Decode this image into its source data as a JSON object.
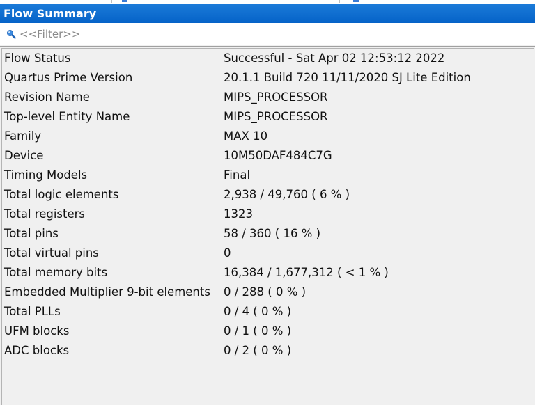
{
  "panel": {
    "title": "Flow Summary"
  },
  "filter": {
    "placeholder": "<<Filter>>",
    "value": ""
  },
  "summary_rows": [
    {
      "key": "Flow Status",
      "value": "Successful - Sat Apr 02 12:53:12 2022"
    },
    {
      "key": "Quartus Prime Version",
      "value": "20.1.1 Build 720 11/11/2020 SJ Lite Edition"
    },
    {
      "key": "Revision Name",
      "value": "MIPS_PROCESSOR"
    },
    {
      "key": "Top-level Entity Name",
      "value": "MIPS_PROCESSOR"
    },
    {
      "key": "Family",
      "value": "MAX 10"
    },
    {
      "key": "Device",
      "value": "10M50DAF484C7G"
    },
    {
      "key": "Timing Models",
      "value": "Final"
    },
    {
      "key": "Total logic elements",
      "value": "2,938 / 49,760 ( 6 % )"
    },
    {
      "key": "Total registers",
      "value": "1323"
    },
    {
      "key": "Total pins",
      "value": "58 / 360 ( 16 % )"
    },
    {
      "key": "Total virtual pins",
      "value": "0"
    },
    {
      "key": "Total memory bits",
      "value": "16,384 / 1,677,312 ( < 1 % )"
    },
    {
      "key": "Embedded Multiplier 9-bit elements",
      "value": "0 / 288 ( 0 % )"
    },
    {
      "key": "Total PLLs",
      "value": "0 / 4 ( 0 % )"
    },
    {
      "key": "UFM blocks",
      "value": "0 / 1 ( 0 % )"
    },
    {
      "key": "ADC blocks",
      "value": "0 / 2 ( 0 % )"
    }
  ],
  "icons": {
    "search": "search-icon"
  },
  "colors": {
    "title_bar": "#0a6ed1",
    "title_text": "#ffffff",
    "background": "#f0f0f0",
    "placeholder_text": "#8a8a8a"
  }
}
